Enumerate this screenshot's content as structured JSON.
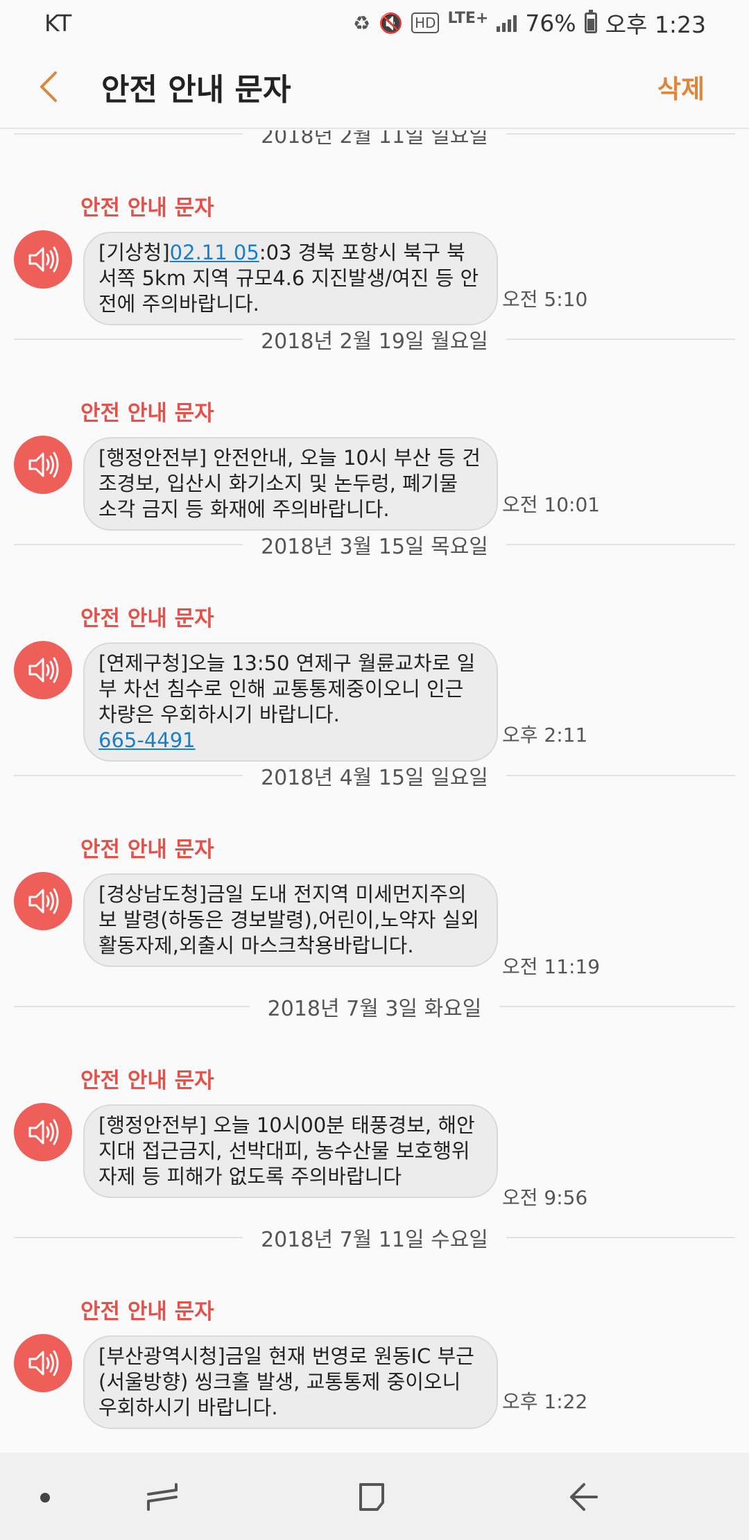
{
  "status_bar": {
    "carrier": "KT",
    "network": "LTE+",
    "battery": "76%",
    "time": "오후 1:23"
  },
  "app_bar": {
    "title": "안전 안내 문자",
    "delete_label": "삭제"
  },
  "messages": [
    {
      "date": "2018년 2월 11일 일요일",
      "sender": "안전 안내 문자",
      "text_before": "[기상청]",
      "link": "02.11 05",
      "text_after": ":03 경북 포항시 북구 북서쪽 5km 지역 규모4.6 지진발생/여진 등 안전에 주의바랍니다.",
      "time": "오전 5:10"
    },
    {
      "date": "2018년 2월 19일 월요일",
      "sender": "안전 안내 문자",
      "text": "[행정안전부] 안전안내, 오늘 10시 부산 등 건조경보, 입산시 화기소지 및 논두렁, 폐기물 소각 금지 등 화재에 주의바랍니다.",
      "time": "오전 10:01"
    },
    {
      "date": "2018년 3월 15일 목요일",
      "sender": "안전 안내 문자",
      "text": "[연제구청]오늘 13:50 연제구 월륜교차로 일부 차선 침수로 인해 교통통제중이오니 인근 차량은 우회하시기 바랍니다.",
      "link": "665-4491",
      "time": "오후 2:11"
    },
    {
      "date": "2018년 4월 15일 일요일",
      "sender": "안전 안내 문자",
      "text": "[경상남도청]금일 도내 전지역 미세먼지주의보 발령(하동은 경보발령),어린이,노약자 실외활동자제,외출시 마스크착용바랍니다.",
      "time": "오전 11:19"
    },
    {
      "date": "2018년 7월 3일 화요일",
      "sender": "안전 안내 문자",
      "text": "[행정안전부] 오늘 10시00분 태풍경보, 해안지대 접근금지, 선박대피, 농수산물 보호행위 자제 등 피해가 없도록 주의바랍니다",
      "time": "오전 9:56"
    },
    {
      "date": "2018년 7월 11일 수요일",
      "sender": "안전 안내 문자",
      "text": "[부산광역시청]금일 현재 번영로 원동IC 부근(서울방향) 씽크홀 발생, 교통통제 중이오니 우회하시기 바랍니다.",
      "time": "오후 1:22"
    }
  ],
  "icons": {
    "back": "chevron-left-icon",
    "avatar": "speaker-icon",
    "nav_recent": "recent-apps-icon",
    "nav_home": "home-icon",
    "nav_back": "back-arrow-icon"
  },
  "colors": {
    "accent": "#e0853c",
    "sender": "#e2524a",
    "avatar": "#ee5f5a",
    "link": "#1a7fc9",
    "bubble": "#ececec"
  }
}
